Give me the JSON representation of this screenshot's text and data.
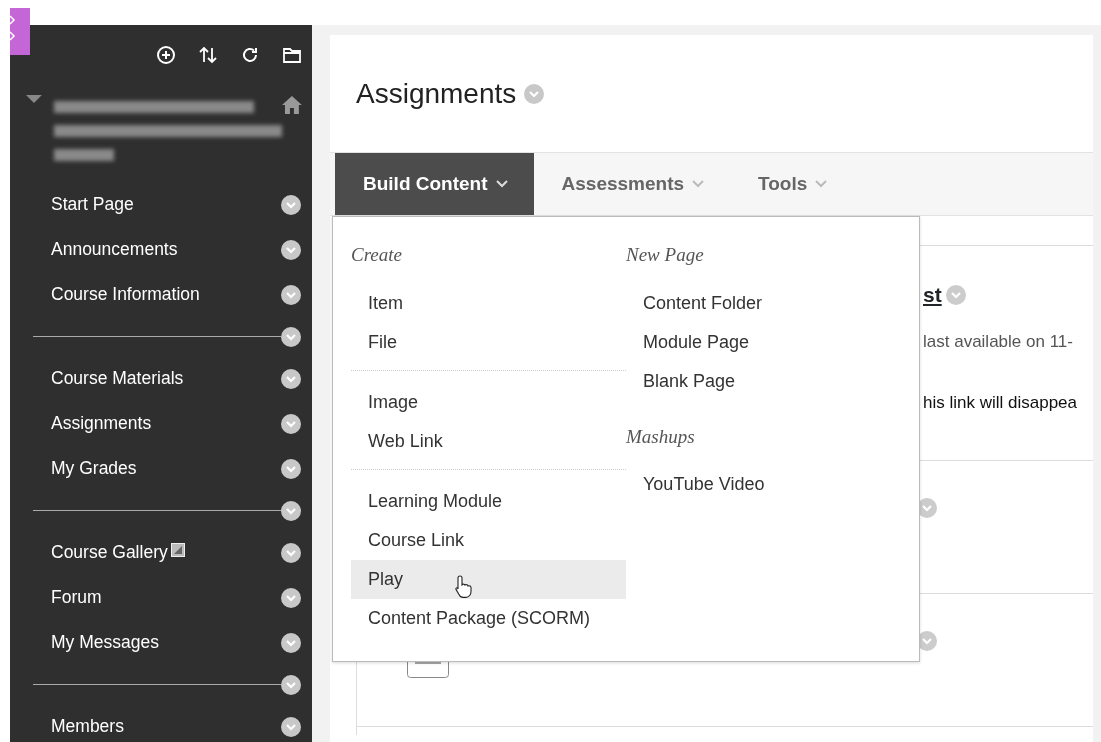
{
  "sidebar": {
    "items": [
      {
        "kind": "link",
        "label": "Start Page"
      },
      {
        "kind": "link",
        "label": "Announcements"
      },
      {
        "kind": "link",
        "label": "Course Information"
      },
      {
        "kind": "divider"
      },
      {
        "kind": "link",
        "label": "Course Materials"
      },
      {
        "kind": "link",
        "label": "Assignments"
      },
      {
        "kind": "link",
        "label": "My Grades"
      },
      {
        "kind": "divider"
      },
      {
        "kind": "link",
        "label": "Course Gallery",
        "external": true
      },
      {
        "kind": "link",
        "label": "Forum"
      },
      {
        "kind": "link",
        "label": "My Messages"
      },
      {
        "kind": "divider"
      },
      {
        "kind": "link",
        "label": "Members"
      }
    ]
  },
  "page_title": "Assignments",
  "tabs": [
    {
      "label": "Build Content",
      "selected": true
    },
    {
      "label": "Assessments",
      "selected": false
    },
    {
      "label": "Tools",
      "selected": false
    }
  ],
  "dropdown": {
    "columns": [
      {
        "heading": "Create",
        "sections": [
          [
            {
              "label": "Item",
              "selected": false
            },
            {
              "label": "File",
              "selected": false
            }
          ],
          [
            {
              "label": "Image",
              "selected": false
            },
            {
              "label": "Web Link",
              "selected": false
            }
          ],
          [
            {
              "label": "Learning Module",
              "selected": false
            },
            {
              "label": "Course Link",
              "selected": false
            },
            {
              "label": "Play",
              "selected": true
            },
            {
              "label": "Content Package (SCORM)",
              "selected": false
            }
          ]
        ]
      },
      {
        "heading": "New Page",
        "sections": [
          [
            {
              "label": "Content Folder",
              "selected": false
            },
            {
              "label": "Module Page",
              "selected": false
            },
            {
              "label": "Blank Page",
              "selected": false
            }
          ]
        ]
      },
      {
        "heading": "Mashups",
        "sections": [
          [
            {
              "label": "YouTube Video",
              "selected": false
            }
          ]
        ]
      }
    ]
  },
  "content": {
    "title": "st",
    "availability": "last available on 11-",
    "note": "his link will disappea"
  }
}
